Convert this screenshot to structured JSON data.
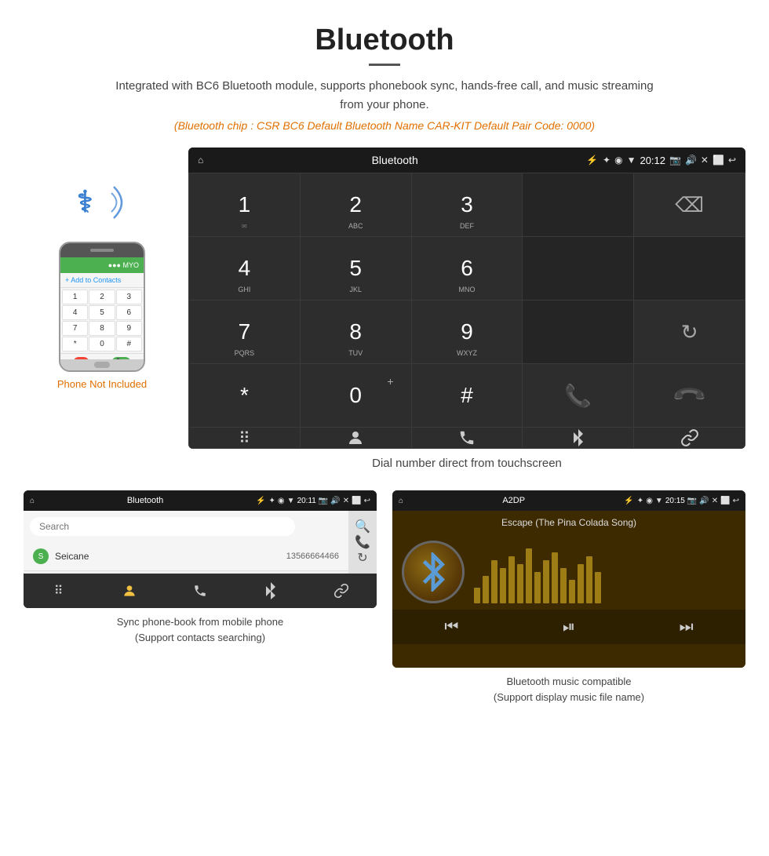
{
  "page": {
    "title": "Bluetooth",
    "divider": true,
    "description": "Integrated with BC6 Bluetooth module, supports phonebook sync, hands-free call, and music streaming from your phone.",
    "specs": "(Bluetooth chip : CSR BC6    Default Bluetooth Name CAR-KIT    Default Pair Code: 0000)"
  },
  "phone_note": "Phone Not Included",
  "dialer_screen": {
    "status_bar": {
      "home": "⌂",
      "title": "Bluetooth",
      "usb": "⚡",
      "bt": "✦",
      "location": "◉",
      "signal": "▼",
      "time": "20:12",
      "camera": "📷",
      "volume": "🔊",
      "close": "✕",
      "window": "⬜",
      "back": "↩"
    },
    "keys": [
      {
        "num": "1",
        "sub": ""
      },
      {
        "num": "2",
        "sub": "ABC"
      },
      {
        "num": "3",
        "sub": "DEF"
      },
      {
        "num": "",
        "sub": ""
      },
      {
        "num": "⌫",
        "sub": ""
      },
      {
        "num": "4",
        "sub": "GHI"
      },
      {
        "num": "5",
        "sub": "JKL"
      },
      {
        "num": "6",
        "sub": "MNO"
      },
      {
        "num": "",
        "sub": ""
      },
      {
        "num": "",
        "sub": ""
      },
      {
        "num": "7",
        "sub": "PQRS"
      },
      {
        "num": "8",
        "sub": "TUV"
      },
      {
        "num": "9",
        "sub": "WXYZ"
      },
      {
        "num": "",
        "sub": ""
      },
      {
        "num": "↻",
        "sub": ""
      },
      {
        "num": "*",
        "sub": ""
      },
      {
        "num": "0",
        "sub": "+"
      },
      {
        "num": "#",
        "sub": ""
      },
      {
        "num": "📞",
        "sub": ""
      },
      {
        "num": "📵",
        "sub": ""
      }
    ],
    "bottom_actions": [
      "⠿",
      "👤",
      "📞",
      "✦",
      "🔗"
    ],
    "caption": "Dial number direct from touchscreen"
  },
  "phonebook_screen": {
    "status_bar": {
      "home": "⌂",
      "title": "Bluetooth",
      "usb": "⚡",
      "bt": "✦",
      "location": "◉",
      "signal": "▼",
      "time": "20:11",
      "camera": "📷",
      "volume": "🔊",
      "close": "✕",
      "window": "⬜",
      "back": "↩"
    },
    "search_placeholder": "Search",
    "contacts": [
      {
        "initial": "S",
        "name": "Seicane",
        "phone": "13566664466"
      }
    ],
    "side_actions": [
      "🔍",
      "📞",
      "↻"
    ],
    "bottom_actions": [
      "⠿",
      "👤",
      "📞",
      "✦",
      "🔗"
    ],
    "caption_line1": "Sync phone-book from mobile phone",
    "caption_line2": "(Support contacts searching)"
  },
  "music_screen": {
    "status_bar": {
      "home": "⌂",
      "title": "A2DP",
      "usb": "⚡",
      "bt": "✦",
      "location": "◉",
      "signal": "▼",
      "time": "20:15",
      "camera": "📷",
      "volume": "🔊",
      "close": "✕",
      "window": "⬜",
      "back": "↩"
    },
    "song_title": "Escape (The Pina Colada Song)",
    "viz_bars": [
      20,
      35,
      55,
      45,
      60,
      50,
      70,
      40,
      55,
      65,
      45,
      30,
      50,
      60,
      40
    ],
    "controls": [
      "⏮",
      "⏯",
      "⏭"
    ],
    "caption_line1": "Bluetooth music compatible",
    "caption_line2": "(Support display music file name)"
  }
}
